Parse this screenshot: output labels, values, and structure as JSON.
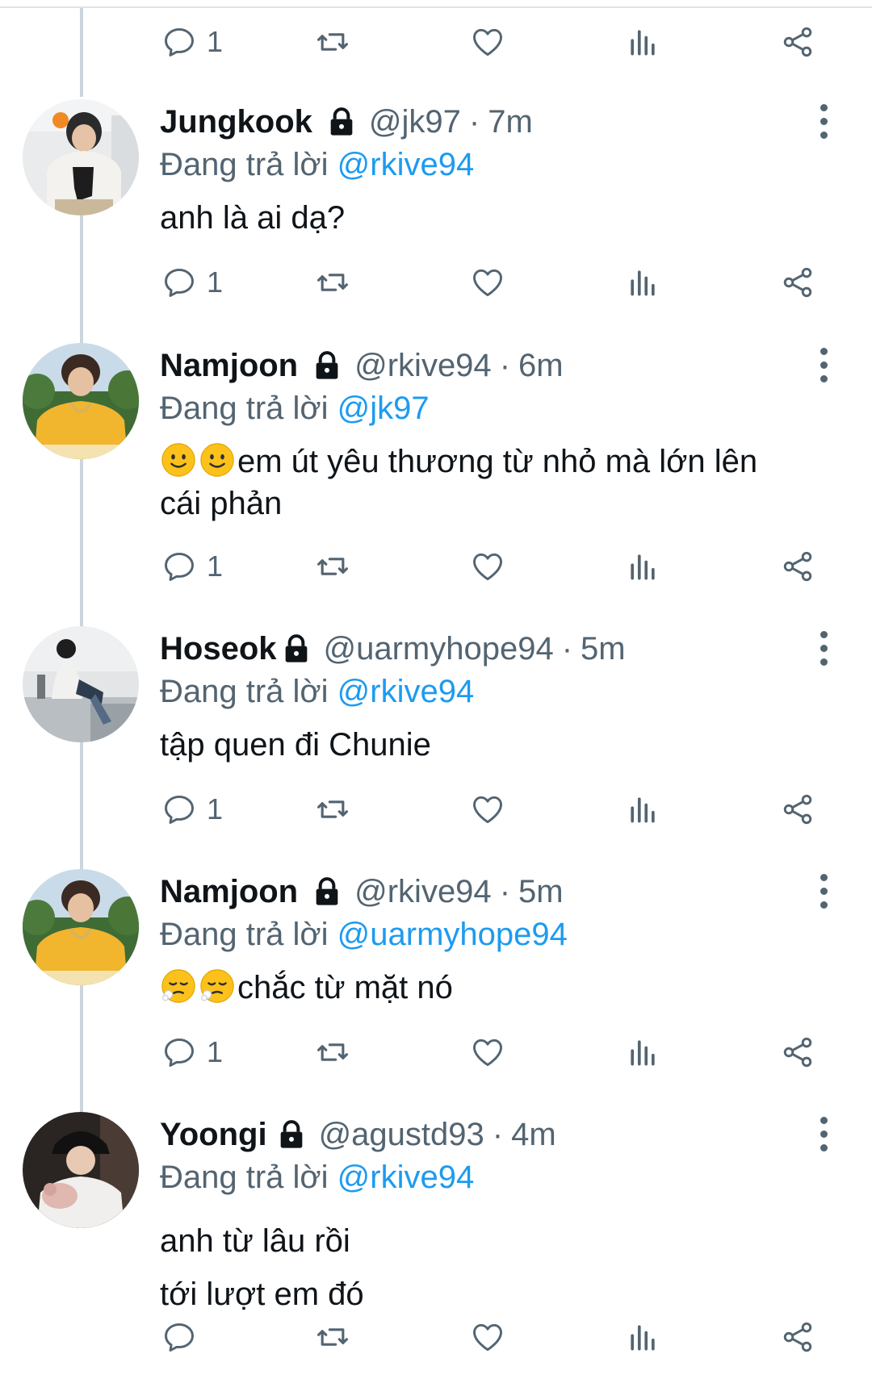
{
  "colors": {
    "text": "#0f1419",
    "secondary": "#536471",
    "mention": "#1d9bf0",
    "thread_line": "#ccd5dc"
  },
  "top_actions": {
    "reply_count": "1"
  },
  "tweets": [
    {
      "name": "Jungkook",
      "handle": "@jk97",
      "dot": "·",
      "time": "7m",
      "reply_prefix": "Đang trả lời",
      "reply_to": "@rkive94",
      "body": [
        "anh là ai dạ?"
      ],
      "emojis": "",
      "reply_count": "1"
    },
    {
      "name": "Namjoon",
      "handle": "@rkive94",
      "dot": "·",
      "time": "6m",
      "reply_prefix": "Đang trả lời",
      "reply_to": "@jk97",
      "body": [
        "em út yêu thương từ nhỏ mà lớn lên",
        "cái phản"
      ],
      "emojis": "slightly-smiling-face x2",
      "reply_count": "1"
    },
    {
      "name": "Hoseok",
      "handle": "@uarmyhope94",
      "dot": "·",
      "time": "5m",
      "reply_prefix": "Đang trả lời",
      "reply_to": "@rkive94",
      "body": [
        "tập quen đi Chunie"
      ],
      "emojis": "",
      "reply_count": "1"
    },
    {
      "name": "Namjoon",
      "handle": "@rkive94",
      "dot": "·",
      "time": "5m",
      "reply_prefix": "Đang trả lời",
      "reply_to": "@uarmyhope94",
      "body": [
        "chắc từ mặt nó"
      ],
      "emojis": "face-exhaling x2",
      "reply_count": "1"
    },
    {
      "name": "Yoongi",
      "handle": "@agustd93",
      "dot": "·",
      "time": "4m",
      "reply_prefix": "Đang trả lời",
      "reply_to": "@rkive94",
      "body": [
        "anh từ lâu rồi",
        "tới lượt em đó"
      ],
      "emojis": "",
      "reply_count": ""
    }
  ],
  "icons": {
    "reply": "reply-bubble-icon",
    "retweet": "retweet-icon",
    "like": "heart-icon",
    "views": "analytics-icon",
    "share": "share-icon",
    "protected": "lock-icon",
    "more": "more-vertical-icon"
  }
}
